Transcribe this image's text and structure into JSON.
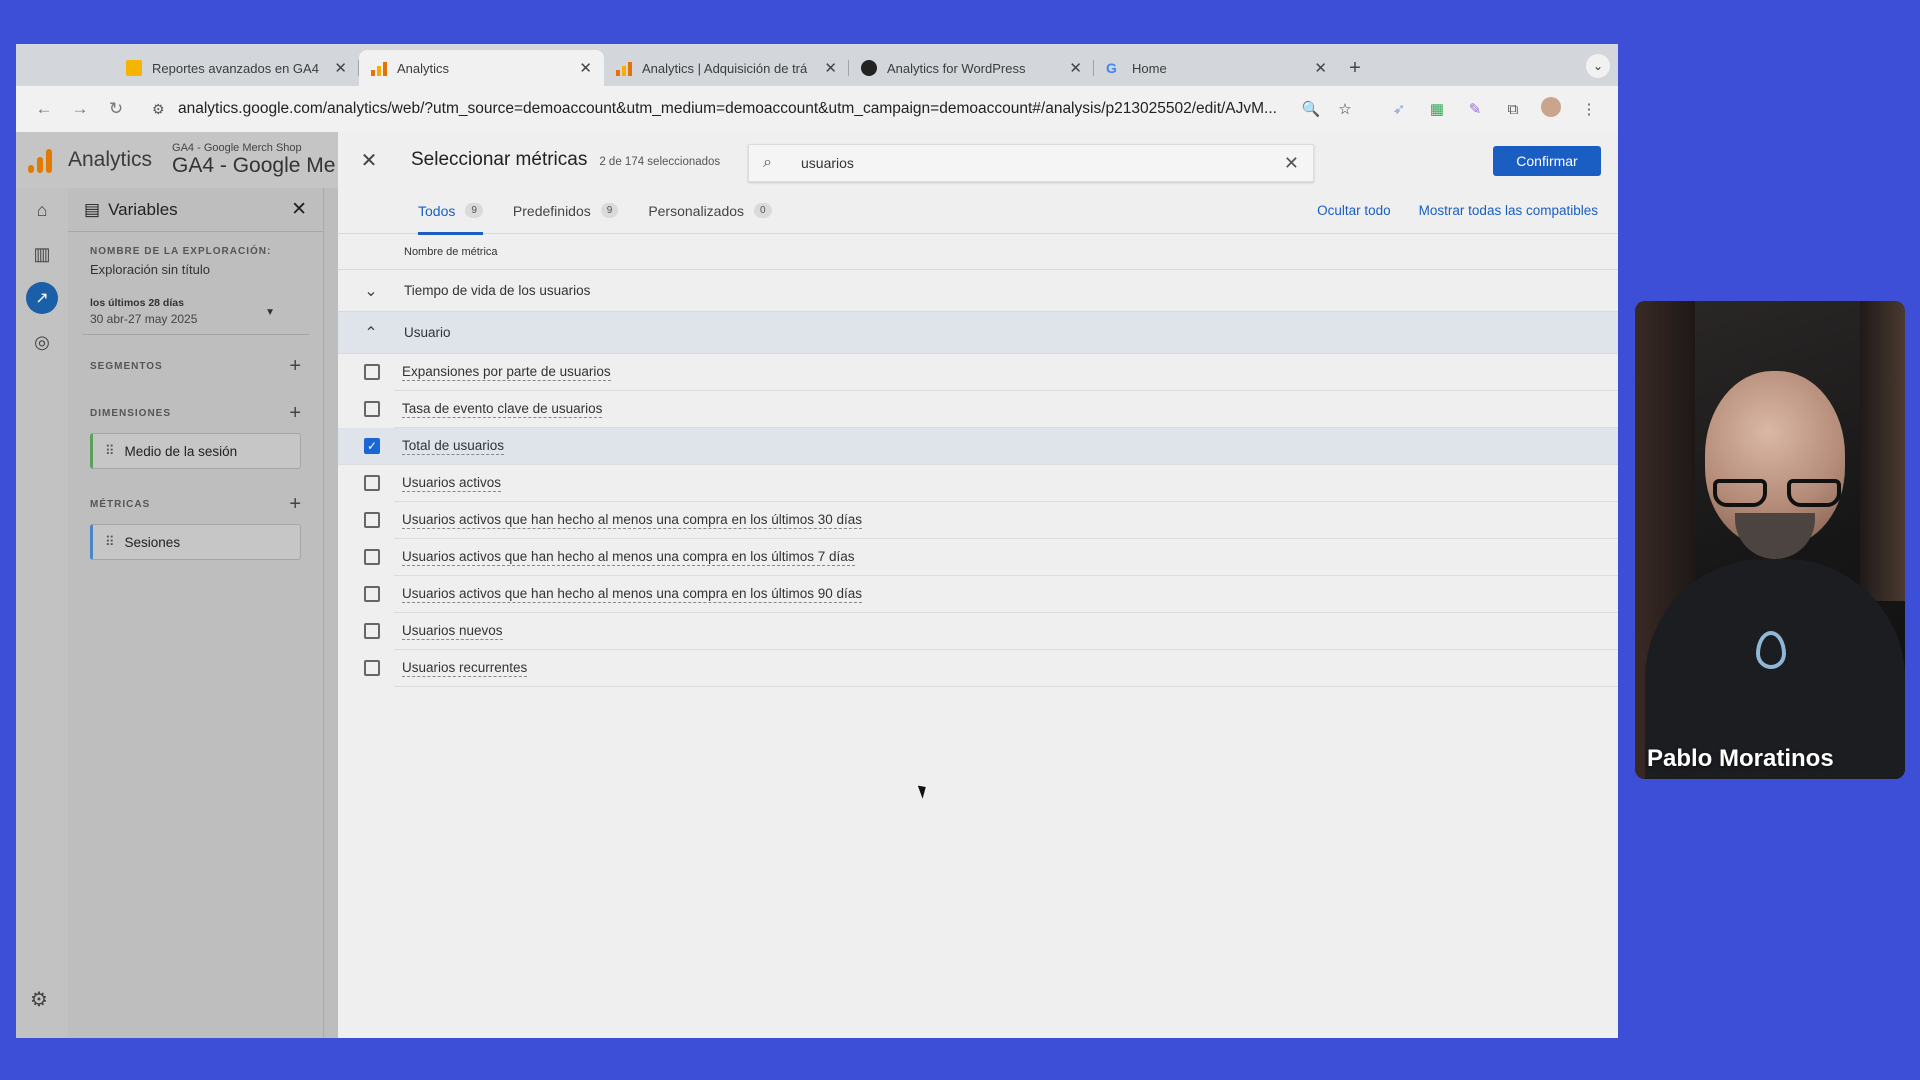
{
  "browser": {
    "tabs": [
      {
        "title": "Reportes avanzados en GA4",
        "icon": "slides-icon",
        "active": false
      },
      {
        "title": "Analytics",
        "icon": "analytics-icon",
        "active": true
      },
      {
        "title": "Analytics | Adquisición de trá",
        "icon": "analytics-icon",
        "active": false
      },
      {
        "title": "Analytics for WordPress",
        "icon": "wordpress-icon",
        "active": false
      },
      {
        "title": "Home",
        "icon": "google-icon",
        "active": false
      }
    ],
    "url": "analytics.google.com/analytics/web/?utm_source=demoaccount&utm_medium=demoaccount&utm_campaign=demoaccount#/analysis/p213025502/edit/AJvM..."
  },
  "ga": {
    "app_name": "Analytics",
    "account_small": "GA4 - Google Merch Shop",
    "account_big": "GA4 - Google Me"
  },
  "variables": {
    "title": "Variables",
    "exploration_label": "NOMBRE DE LA EXPLORACIÓN:",
    "exploration_name": "Exploración sin título",
    "date_label": "los últimos 28 días",
    "date_value": "30 abr-27 may 2025",
    "segments_label": "SEGMENTOS",
    "dimensions_label": "DIMENSIONES",
    "dimension_item": "Medio de la sesión",
    "metrics_label": "MÉTRICAS",
    "metric_item": "Sesiones"
  },
  "drawer": {
    "title": "Seleccionar métricas",
    "count": "2 de 174 seleccionados",
    "search_value": "usuarios",
    "confirm": "Confirmar",
    "tabs": [
      {
        "label": "Todos",
        "count": "9"
      },
      {
        "label": "Predefinidos",
        "count": "9"
      },
      {
        "label": "Personalizados",
        "count": "0"
      }
    ],
    "hide_all": "Ocultar todo",
    "show_compatible": "Mostrar todas las compatibles",
    "column_header": "Nombre de métrica",
    "group_collapsed": "Tiempo de vida de los usuarios",
    "group_open": "Usuario",
    "metrics": [
      {
        "label": "Expansiones por parte de usuarios",
        "checked": false
      },
      {
        "label": "Tasa de evento clave de usuarios",
        "checked": false
      },
      {
        "label": "Total de usuarios",
        "checked": true
      },
      {
        "label": "Usuarios activos",
        "checked": false
      },
      {
        "label": "Usuarios activos que han hecho al menos una compra en los últimos 30 días",
        "checked": false
      },
      {
        "label": "Usuarios activos que han hecho al menos una compra en los últimos 7 días",
        "checked": false
      },
      {
        "label": "Usuarios activos que han hecho al menos una compra en los últimos 90 días",
        "checked": false
      },
      {
        "label": "Usuarios nuevos",
        "checked": false
      },
      {
        "label": "Usuarios recurrentes",
        "checked": false
      }
    ]
  },
  "webcam": {
    "name": "Pablo Moratinos"
  },
  "colors": {
    "accent": "#1a5ec4",
    "background_plus": "#3d4fd6",
    "ga_orange": "#e07b00"
  }
}
